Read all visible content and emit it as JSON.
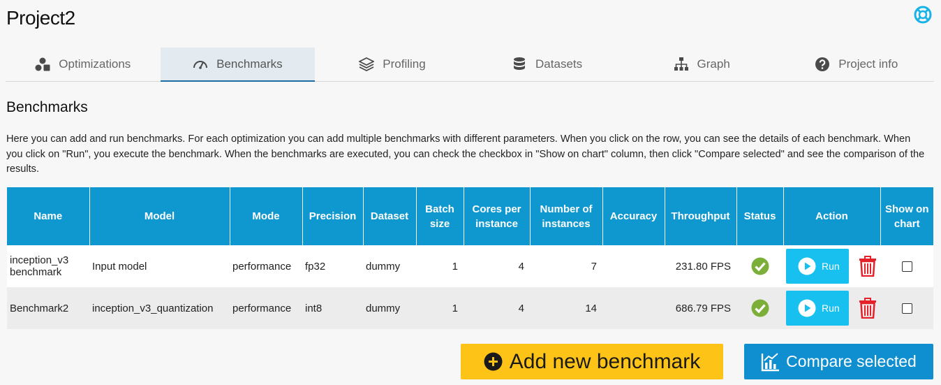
{
  "project": {
    "title": "Project2"
  },
  "tabs": [
    {
      "label": "Optimizations",
      "icon": "optimizations-icon"
    },
    {
      "label": "Benchmarks",
      "icon": "gauge-icon",
      "active": true
    },
    {
      "label": "Profiling",
      "icon": "layers-icon"
    },
    {
      "label": "Datasets",
      "icon": "database-icon"
    },
    {
      "label": "Graph",
      "icon": "graph-icon"
    },
    {
      "label": "Project info",
      "icon": "question-icon"
    }
  ],
  "section": {
    "title": "Benchmarks",
    "description": "Here you can add and run benchmarks. For each optimization you can add multiple benchmarks with different parameters. When you click on the row, you can see the details of each benchmark. When you click on \"Run\", you execute the benchmark. When the benchmarks are executed, you can check the checkbox in \"Show on chart\" column, then click \"Compare selected\" and see the comparison of the results."
  },
  "table": {
    "headers": {
      "name": "Name",
      "model": "Model",
      "mode": "Mode",
      "precision": "Precision",
      "dataset": "Dataset",
      "batch_size": "Batch size",
      "cores": "Cores per instance",
      "instances": "Number of instances",
      "accuracy": "Accuracy",
      "throughput": "Throughput",
      "status": "Status",
      "action": "Action",
      "show_on_chart": "Show on chart"
    },
    "rows": [
      {
        "name": "inception_v3 benchmark",
        "model": "Input model",
        "mode": "performance",
        "precision": "fp32",
        "dataset": "dummy",
        "batch_size": "1",
        "cores": "4",
        "instances": "7",
        "accuracy": "",
        "throughput": "231.80 FPS",
        "status": "success",
        "run_label": "Run",
        "checked": false
      },
      {
        "name": "Benchmark2",
        "model": "inception_v3_quantization",
        "mode": "performance",
        "precision": "int8",
        "dataset": "dummy",
        "batch_size": "1",
        "cores": "4",
        "instances": "14",
        "accuracy": "",
        "throughput": "686.79 FPS",
        "status": "success",
        "run_label": "Run",
        "checked": false
      }
    ]
  },
  "buttons": {
    "add_new": "Add new benchmark",
    "compare": "Compare selected"
  },
  "colors": {
    "header_blue": "#0f97cf",
    "run_button": "#17c0ef",
    "add_button": "#fdc316",
    "compare_button": "#0f8ed0",
    "status_ok": "#7cae3a",
    "delete_red": "#e5212a"
  }
}
